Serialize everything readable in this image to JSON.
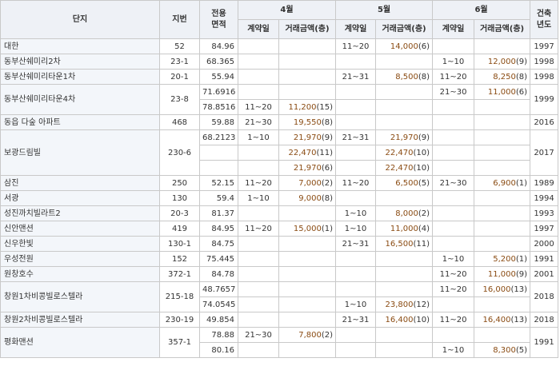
{
  "headers": {
    "complex": "단지",
    "lot": "지번",
    "area_line1": "전용",
    "area_line2": "면적",
    "months": [
      "4월",
      "5월",
      "6월"
    ],
    "contract_day": "계약일",
    "amount": "거래금액(층)",
    "built_line1": "건축",
    "built_line2": "년도"
  },
  "rows": [
    {
      "name": "대한",
      "lot": "52",
      "year": "1997",
      "lines": [
        {
          "area": "84.96",
          "m": [
            null,
            {
              "d": "11~20",
              "a": "14,000",
              "f": "(6)"
            },
            null
          ]
        }
      ]
    },
    {
      "name": "동부산쉐미리2차",
      "lot": "23-1",
      "year": "1998",
      "lines": [
        {
          "area": "68.365",
          "m": [
            null,
            null,
            {
              "d": "1~10",
              "a": "12,000",
              "f": "(9)"
            }
          ]
        }
      ]
    },
    {
      "name": "동부산쉐미리타운1차",
      "lot": "20-1",
      "year": "1998",
      "lines": [
        {
          "area": "55.94",
          "m": [
            null,
            {
              "d": "21~31",
              "a": "8,500",
              "f": "(8)"
            },
            {
              "d": "11~20",
              "a": "8,250",
              "f": "(8)"
            }
          ]
        }
      ]
    },
    {
      "name": "동부산쉐미리타운4차",
      "lot": "23-8",
      "year": "1999",
      "lines": [
        {
          "area": "71.6916",
          "m": [
            null,
            null,
            {
              "d": "21~30",
              "a": "11,000",
              "f": "(6)"
            }
          ]
        },
        {
          "area": "78.8516",
          "m": [
            {
              "d": "11~20",
              "a": "11,200",
              "f": "(15)"
            },
            null,
            null
          ]
        }
      ]
    },
    {
      "name": "동읍 다숲 아파트",
      "lot": "468",
      "year": "2016",
      "lines": [
        {
          "area": "59.88",
          "m": [
            {
              "d": "21~30",
              "a": "19,550",
              "f": "(8)"
            },
            null,
            null
          ]
        }
      ]
    },
    {
      "name": "보광드림빌",
      "lot": "230-6",
      "year": "2017",
      "lines": [
        {
          "area": "68.2123",
          "m": [
            {
              "d": "1~10",
              "a": "21,970",
              "f": "(9)"
            },
            {
              "d": "21~31",
              "a": "21,970",
              "f": "(9)"
            },
            null
          ]
        },
        {
          "area": "",
          "m": [
            {
              "d": "",
              "a": "22,470",
              "f": "(11)"
            },
            {
              "d": "",
              "a": "22,470",
              "f": "(10)"
            },
            null
          ]
        },
        {
          "area": "",
          "m": [
            {
              "d": "",
              "a": "21,970",
              "f": "(6)"
            },
            {
              "d": "",
              "a": "22,470",
              "f": "(10)"
            },
            null
          ]
        }
      ]
    },
    {
      "name": "삼진",
      "lot": "250",
      "year": "1989",
      "lines": [
        {
          "area": "52.15",
          "m": [
            {
              "d": "11~20",
              "a": "7,000",
              "f": "(2)"
            },
            {
              "d": "11~20",
              "a": "6,500",
              "f": "(5)"
            },
            {
              "d": "21~30",
              "a": "6,900",
              "f": "(1)"
            }
          ]
        }
      ]
    },
    {
      "name": "서광",
      "lot": "130",
      "year": "1994",
      "lines": [
        {
          "area": "59.4",
          "m": [
            {
              "d": "1~10",
              "a": "9,000",
              "f": "(8)"
            },
            null,
            null
          ]
        }
      ]
    },
    {
      "name": "성진까치빌라트2",
      "lot": "20-3",
      "year": "1993",
      "lines": [
        {
          "area": "81.37",
          "m": [
            null,
            {
              "d": "1~10",
              "a": "8,000",
              "f": "(2)"
            },
            null
          ]
        }
      ]
    },
    {
      "name": "신안맨션",
      "lot": "419",
      "year": "1997",
      "lines": [
        {
          "area": "84.95",
          "m": [
            {
              "d": "11~20",
              "a": "15,000",
              "f": "(1)"
            },
            {
              "d": "1~10",
              "a": "11,000",
              "f": "(4)"
            },
            null
          ]
        }
      ]
    },
    {
      "name": "신우한빛",
      "lot": "130-1",
      "year": "2000",
      "lines": [
        {
          "area": "84.75",
          "m": [
            null,
            {
              "d": "21~31",
              "a": "16,500",
              "f": "(11)"
            },
            null
          ]
        }
      ]
    },
    {
      "name": "우성전원",
      "lot": "152",
      "year": "1991",
      "lines": [
        {
          "area": "75.445",
          "m": [
            null,
            null,
            {
              "d": "1~10",
              "a": "5,200",
              "f": "(1)"
            }
          ]
        }
      ]
    },
    {
      "name": "원창호수",
      "lot": "372-1",
      "year": "2001",
      "lines": [
        {
          "area": "84.78",
          "m": [
            null,
            null,
            {
              "d": "11~20",
              "a": "11,000",
              "f": "(9)"
            }
          ]
        }
      ]
    },
    {
      "name": "창원1차비콩빌로스텔라",
      "lot": "215-18",
      "year": "2018",
      "lines": [
        {
          "area": "48.7657",
          "m": [
            null,
            null,
            {
              "d": "11~20",
              "a": "16,000",
              "f": "(13)"
            }
          ]
        },
        {
          "area": "74.0545",
          "m": [
            null,
            {
              "d": "1~10",
              "a": "23,800",
              "f": "(12)"
            },
            null
          ]
        }
      ]
    },
    {
      "name": "창원2차비콩빌로스텔라",
      "lot": "230-19",
      "year": "2018",
      "lines": [
        {
          "area": "49.854",
          "m": [
            null,
            {
              "d": "21~31",
              "a": "16,400",
              "f": "(10)"
            },
            {
              "d": "11~20",
              "a": "16,400",
              "f": "(13)"
            }
          ]
        }
      ]
    },
    {
      "name": "평화맨션",
      "lot": "357-1",
      "year": "1991",
      "lines": [
        {
          "area": "78.88",
          "m": [
            {
              "d": "21~30",
              "a": "7,800",
              "f": "(2)"
            },
            null,
            null
          ]
        },
        {
          "area": "80.16",
          "m": [
            null,
            null,
            {
              "d": "1~10",
              "a": "8,300",
              "f": "(5)"
            }
          ]
        }
      ]
    }
  ]
}
